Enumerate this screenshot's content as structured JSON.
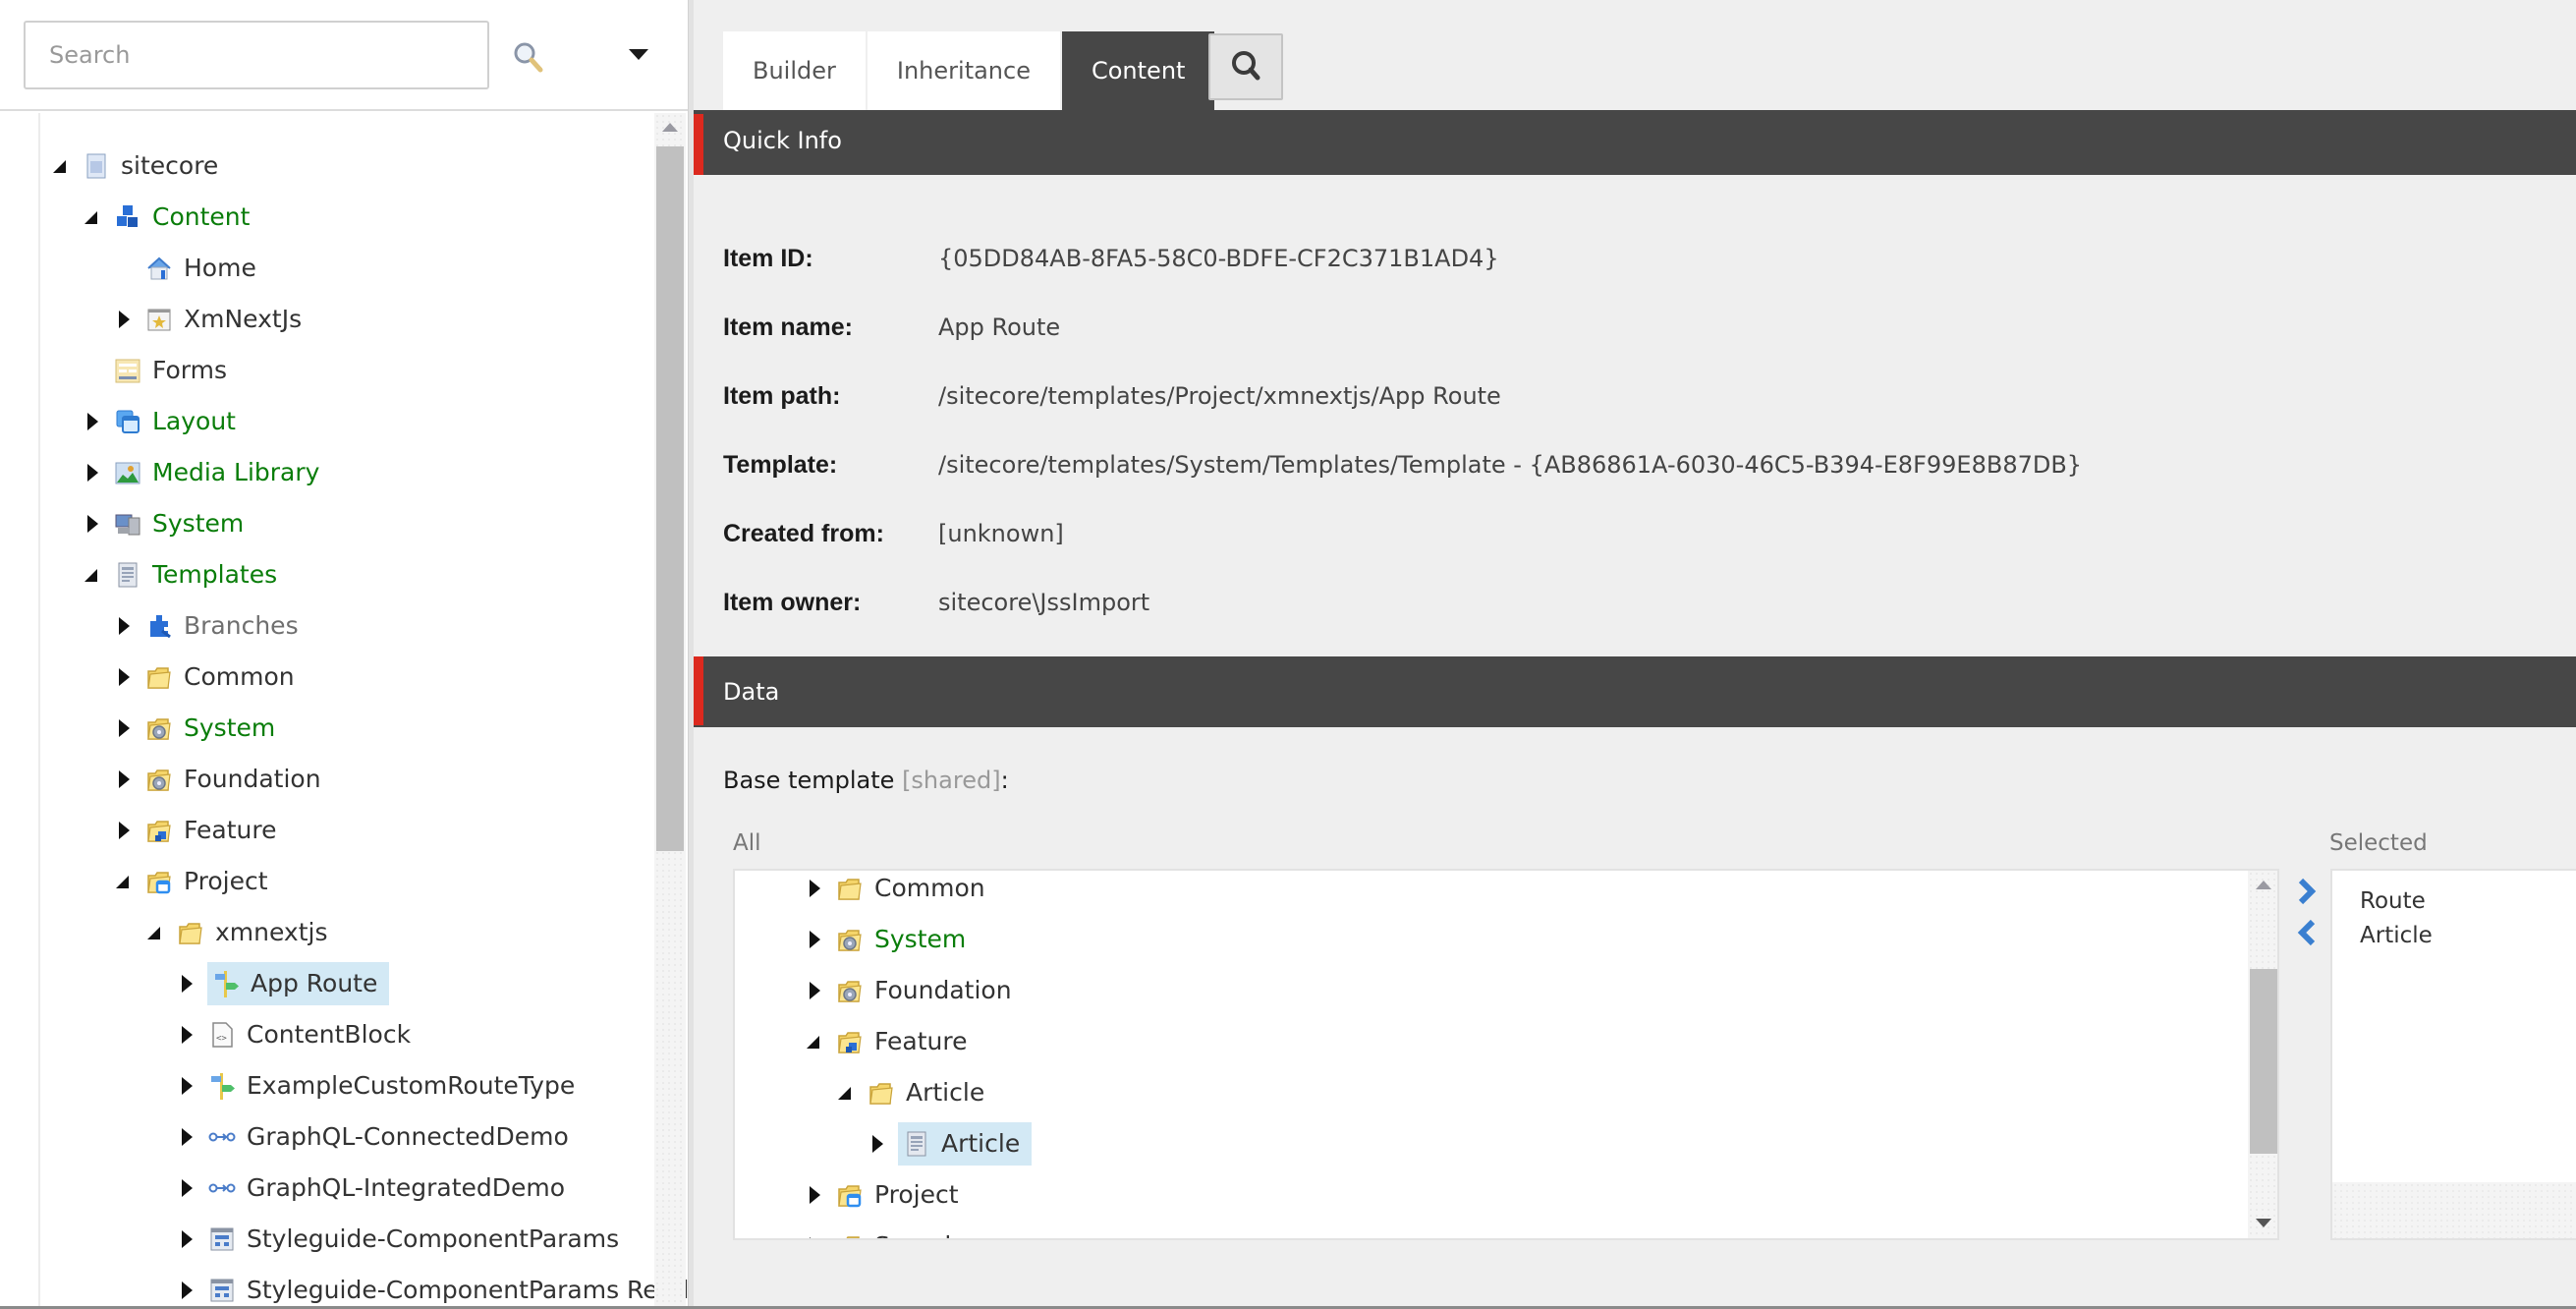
{
  "left_panel": {
    "search": {
      "placeholder": "Search",
      "value": ""
    },
    "search_icon": "magnifier-icon",
    "dropdown_icon": "caret-down-icon",
    "tree": [
      {
        "label": "sitecore",
        "level": 0,
        "toggle": "expanded",
        "icon": "sitecore-root-icon",
        "color": "dark"
      },
      {
        "label": "Content",
        "level": 1,
        "toggle": "expanded",
        "icon": "content-cubes-icon",
        "color": "green"
      },
      {
        "label": "Home",
        "level": 2,
        "toggle": "none",
        "icon": "home-icon",
        "color": "dark"
      },
      {
        "label": "XmNextJs",
        "level": 2,
        "toggle": "collapsed",
        "icon": "site-star-icon",
        "color": "dark"
      },
      {
        "label": "Forms",
        "level": 1,
        "toggle": "none",
        "icon": "forms-icon",
        "color": "dark"
      },
      {
        "label": "Layout",
        "level": 1,
        "toggle": "collapsed",
        "icon": "layout-icon",
        "color": "green"
      },
      {
        "label": "Media Library",
        "level": 1,
        "toggle": "collapsed",
        "icon": "media-library-icon",
        "color": "green"
      },
      {
        "label": "System",
        "level": 1,
        "toggle": "collapsed",
        "icon": "system-computer-icon",
        "color": "green"
      },
      {
        "label": "Templates",
        "level": 1,
        "toggle": "expanded",
        "icon": "templates-icon",
        "color": "green"
      },
      {
        "label": "Branches",
        "level": 2,
        "toggle": "collapsed",
        "icon": "branches-puzzle-icon",
        "color": "gray"
      },
      {
        "label": "Common",
        "level": 2,
        "toggle": "collapsed",
        "icon": "folder-icon",
        "color": "dark"
      },
      {
        "label": "System",
        "level": 2,
        "toggle": "collapsed",
        "icon": "folder-gear-icon",
        "color": "green"
      },
      {
        "label": "Foundation",
        "level": 2,
        "toggle": "collapsed",
        "icon": "folder-gear-icon",
        "color": "dark"
      },
      {
        "label": "Feature",
        "level": 2,
        "toggle": "collapsed",
        "icon": "folder-feature-icon",
        "color": "dark"
      },
      {
        "label": "Project",
        "level": 2,
        "toggle": "expanded",
        "icon": "folder-project-icon",
        "color": "dark"
      },
      {
        "label": "xmnextjs",
        "level": 3,
        "toggle": "expanded",
        "icon": "folder-icon",
        "color": "dark"
      },
      {
        "label": "App Route",
        "level": 4,
        "toggle": "collapsed",
        "icon": "route-signpost-icon",
        "color": "dark",
        "selected": true
      },
      {
        "label": "ContentBlock",
        "level": 4,
        "toggle": "collapsed",
        "icon": "code-file-icon",
        "color": "dark"
      },
      {
        "label": "ExampleCustomRouteType",
        "level": 4,
        "toggle": "collapsed",
        "icon": "route-signpost-icon",
        "color": "dark"
      },
      {
        "label": "GraphQL-ConnectedDemo",
        "level": 4,
        "toggle": "collapsed",
        "icon": "graphql-link-icon",
        "color": "dark"
      },
      {
        "label": "GraphQL-IntegratedDemo",
        "level": 4,
        "toggle": "collapsed",
        "icon": "graphql-link-icon",
        "color": "dark"
      },
      {
        "label": "Styleguide-ComponentParams",
        "level": 4,
        "toggle": "collapsed",
        "icon": "component-params-icon",
        "color": "dark"
      },
      {
        "label": "Styleguide-ComponentParams Rend",
        "level": 4,
        "toggle": "collapsed",
        "icon": "component-params-icon",
        "color": "dark"
      }
    ]
  },
  "right_panel": {
    "tabs": [
      {
        "label": "Builder",
        "active": false
      },
      {
        "label": "Inheritance",
        "active": false
      },
      {
        "label": "Content",
        "active": true
      }
    ],
    "tab_search_icon": "search-icon",
    "quick_info": {
      "title": "Quick Info",
      "rows": [
        {
          "key": "Item ID:",
          "value": "{05DD84AB-8FA5-58C0-BDFE-CF2C371B1AD4}"
        },
        {
          "key": "Item name:",
          "value": "App Route"
        },
        {
          "key": "Item path:",
          "value": "/sitecore/templates/Project/xmnextjs/App Route"
        },
        {
          "key": "Template:",
          "value": "/sitecore/templates/System/Templates/Template - {AB86861A-6030-46C5-B394-E8F99E8B87DB}"
        },
        {
          "key": "Created from:",
          "value": "[unknown]"
        },
        {
          "key": "Item owner:",
          "value": "sitecore\\JssImport"
        }
      ]
    },
    "data_section": {
      "title": "Data",
      "base_template_label": "Base template",
      "shared_tag": "[shared]",
      "colon": ":",
      "all_label": "All",
      "selected_label": "Selected",
      "all_tree": [
        {
          "label": "Common",
          "level": 0,
          "toggle": "collapsed",
          "icon": "folder-icon",
          "color": "dark"
        },
        {
          "label": "System",
          "level": 0,
          "toggle": "collapsed",
          "icon": "folder-gear-icon",
          "color": "green"
        },
        {
          "label": "Foundation",
          "level": 0,
          "toggle": "collapsed",
          "icon": "folder-gear-icon",
          "color": "dark"
        },
        {
          "label": "Feature",
          "level": 0,
          "toggle": "expanded",
          "icon": "folder-feature-icon",
          "color": "dark"
        },
        {
          "label": "Article",
          "level": 1,
          "toggle": "expanded",
          "icon": "folder-icon",
          "color": "dark"
        },
        {
          "label": "Article",
          "level": 2,
          "toggle": "collapsed",
          "icon": "template-icon",
          "color": "dark",
          "selected": true
        },
        {
          "label": "Project",
          "level": 0,
          "toggle": "collapsed",
          "icon": "folder-project-icon",
          "color": "dark"
        },
        {
          "label": "Sample",
          "level": 0,
          "toggle": "collapsed",
          "icon": "folder-icon",
          "color": "dark"
        }
      ],
      "move_right_icon": "chevron-right-icon",
      "move_left_icon": "chevron-left-icon",
      "selected_items": [
        "Route",
        "Article"
      ]
    }
  }
}
